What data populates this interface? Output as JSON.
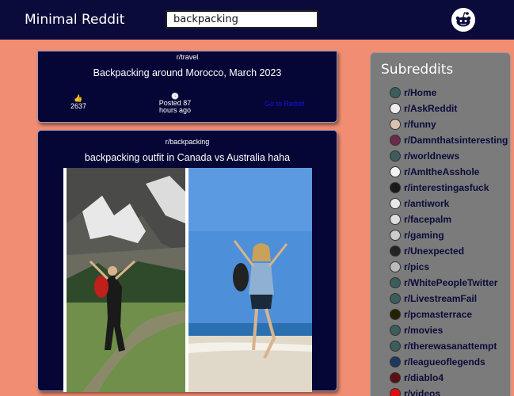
{
  "app": {
    "title": "Minimal Reddit"
  },
  "search": {
    "value": "backpacking"
  },
  "logo": {
    "icon": "reddit-alien-icon"
  },
  "posts": [
    {
      "subreddit": "r/travel",
      "title": "Backpacking around Morocco, March 2023",
      "votes": "2637",
      "posted": "Posted 87 hours ago",
      "link": "Go to Reddit"
    },
    {
      "subreddit": "r/backpacking",
      "title": "backpacking outfit in Canada vs Australia haha"
    }
  ],
  "sidebar": {
    "title": "Subreddits",
    "items": [
      {
        "label": "r/Home",
        "color": "#3d5c5c"
      },
      {
        "label": "r/AskReddit",
        "color": "#eeeeee"
      },
      {
        "label": "r/funny",
        "color": "#d9c3b0"
      },
      {
        "label": "r/Damnthatsinteresting",
        "color": "#6b2a4a"
      },
      {
        "label": "r/worldnews",
        "color": "#3d5c5c"
      },
      {
        "label": "r/AmItheAsshole",
        "color": "#f2f2f2"
      },
      {
        "label": "r/interestingasfuck",
        "color": "#1a1a1a"
      },
      {
        "label": "r/antiwork",
        "color": "#e8e8e8"
      },
      {
        "label": "r/facepalm",
        "color": "#dddddd"
      },
      {
        "label": "r/gaming",
        "color": "#cccccc"
      },
      {
        "label": "r/Unexpected",
        "color": "#222222"
      },
      {
        "label": "r/pics",
        "color": "#bbbbbb"
      },
      {
        "label": "r/WhitePeopleTwitter",
        "color": "#3d5c5c"
      },
      {
        "label": "r/LivestreamFail",
        "color": "#3d5c5c"
      },
      {
        "label": "r/pcmasterrace",
        "color": "#222200"
      },
      {
        "label": "r/movies",
        "color": "#3d5c5c"
      },
      {
        "label": "r/therewasanattempt",
        "color": "#3d5c5c"
      },
      {
        "label": "r/leagueoflegends",
        "color": "#1b3a5c"
      },
      {
        "label": "r/diablo4",
        "color": "#5a1010"
      },
      {
        "label": "r/videos",
        "color": "#e01010"
      }
    ]
  }
}
